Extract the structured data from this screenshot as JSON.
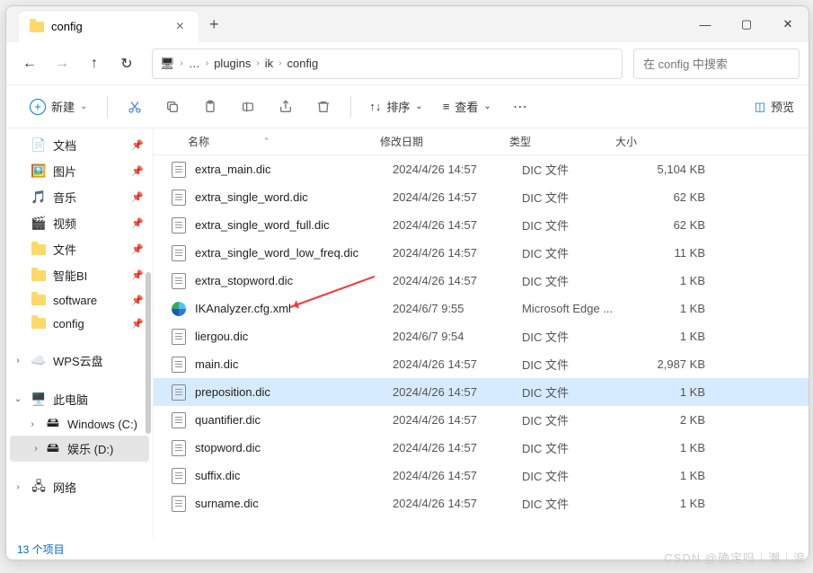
{
  "tab_title": "config",
  "new_button": "新建",
  "sort_label": "排序",
  "view_label": "查看",
  "preview_label": "预览",
  "breadcrumbs": [
    "plugins",
    "ik",
    "config"
  ],
  "search_placeholder": "在 config 中搜索",
  "columns": {
    "name": "名称",
    "date": "修改日期",
    "type": "类型",
    "size": "大小"
  },
  "sidebar": {
    "items": [
      {
        "label": "文档",
        "icon": "doc",
        "pin": true
      },
      {
        "label": "图片",
        "icon": "pic",
        "pin": true
      },
      {
        "label": "音乐",
        "icon": "music",
        "pin": true
      },
      {
        "label": "视频",
        "icon": "video",
        "pin": true
      },
      {
        "label": "文件",
        "icon": "folder",
        "pin": true
      },
      {
        "label": "智能BI",
        "icon": "folder",
        "pin": true
      },
      {
        "label": "software",
        "icon": "folder",
        "pin": true
      },
      {
        "label": "config",
        "icon": "folder",
        "pin": true
      }
    ],
    "wps": "WPS云盘",
    "thispc": "此电脑",
    "drives": [
      {
        "label": "Windows (C:)"
      },
      {
        "label": "娱乐 (D:)",
        "selected": true
      }
    ],
    "network": "网络"
  },
  "files": [
    {
      "name": "extra_main.dic",
      "date": "2024/4/26 14:57",
      "type": "DIC 文件",
      "size": "5,104 KB",
      "icon": "file"
    },
    {
      "name": "extra_single_word.dic",
      "date": "2024/4/26 14:57",
      "type": "DIC 文件",
      "size": "62 KB",
      "icon": "file"
    },
    {
      "name": "extra_single_word_full.dic",
      "date": "2024/4/26 14:57",
      "type": "DIC 文件",
      "size": "62 KB",
      "icon": "file"
    },
    {
      "name": "extra_single_word_low_freq.dic",
      "date": "2024/4/26 14:57",
      "type": "DIC 文件",
      "size": "11 KB",
      "icon": "file"
    },
    {
      "name": "extra_stopword.dic",
      "date": "2024/4/26 14:57",
      "type": "DIC 文件",
      "size": "1 KB",
      "icon": "file"
    },
    {
      "name": "IKAnalyzer.cfg.xml",
      "date": "2024/6/7 9:55",
      "type": "Microsoft Edge ...",
      "size": "1 KB",
      "icon": "edge"
    },
    {
      "name": "liergou.dic",
      "date": "2024/6/7 9:54",
      "type": "DIC 文件",
      "size": "1 KB",
      "icon": "file"
    },
    {
      "name": "main.dic",
      "date": "2024/4/26 14:57",
      "type": "DIC 文件",
      "size": "2,987 KB",
      "icon": "file"
    },
    {
      "name": "preposition.dic",
      "date": "2024/4/26 14:57",
      "type": "DIC 文件",
      "size": "1 KB",
      "icon": "file",
      "selected": true
    },
    {
      "name": "quantifier.dic",
      "date": "2024/4/26 14:57",
      "type": "DIC 文件",
      "size": "2 KB",
      "icon": "file"
    },
    {
      "name": "stopword.dic",
      "date": "2024/4/26 14:57",
      "type": "DIC 文件",
      "size": "1 KB",
      "icon": "file"
    },
    {
      "name": "suffix.dic",
      "date": "2024/4/26 14:57",
      "type": "DIC 文件",
      "size": "1 KB",
      "icon": "file"
    },
    {
      "name": "surname.dic",
      "date": "2024/4/26 14:57",
      "type": "DIC 文件",
      "size": "1 KB",
      "icon": "file"
    }
  ],
  "status": "13 个项目",
  "watermark": "CSDN @确定吗｜潮｜浪"
}
